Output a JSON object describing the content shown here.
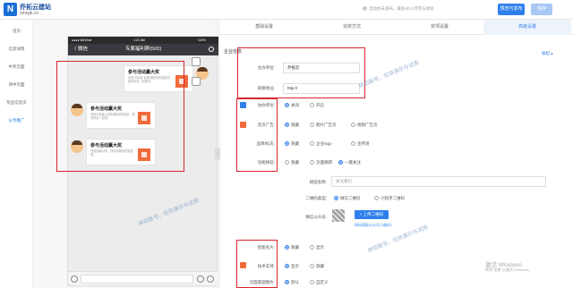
{
  "header": {
    "logo_mark": "N",
    "logo_name": "乔拓云建站",
    "logo_url": "xmsgk.cn",
    "notice": "活动尚未发布，最多20人可参与体验",
    "publish_label": "预览与发布",
    "save_label": "保存"
  },
  "nav": {
    "items": [
      "首页",
      "信息详情",
      "中奖页面",
      "领中页面",
      "奖品信息页",
      "分享推广"
    ]
  },
  "phone": {
    "carrier": "●●●● WeChat",
    "time": "1:21 AM",
    "battery": "100%",
    "back_label": "〈 微信",
    "title": "专属福利群(500)",
    "messages": [
      {
        "title": "参与活动赢大奖",
        "desc": "你是中奖者! 赶快领取你的奖品吧，邀请好友一起参与。"
      },
      {
        "title": "参与活动赢大奖",
        "desc": "你是中奖者! 赶快领取你的奖品，邀请好友一起来。"
      },
      {
        "title": "参与活动赢大奖",
        "desc": "开奖结果公布，快来领取你的奖品吧。"
      }
    ]
  },
  "tabs": [
    "基础设置",
    "派奖方式",
    "奖项设置",
    "高级设置"
  ],
  "settings": {
    "section_title": "企业信息",
    "collapse_link": "收起 ▴",
    "sponsor_label": "主办单位:",
    "sponsor_value": "乔拓云",
    "url_label": "链接地址:",
    "url_value": "http://",
    "coorg_label": "协办单位:",
    "coorg_options": [
      "关闭",
      "开启"
    ],
    "ad_label": "首页广告:",
    "ad_options": [
      "隐藏",
      "图片广告页",
      "视频广告页"
    ],
    "brand_label": "品牌/标志:",
    "brand_options": [
      "隐藏",
      "企业logo",
      "宣传语"
    ],
    "func_label": "功能按钮:",
    "func_options": [
      "隐藏",
      "页面跳转",
      "一键关注"
    ],
    "btn_name_label": "按钮名称:",
    "btn_name_value": "关注我们",
    "qr_type_label": "二维码类型:",
    "qr_type_options": [
      "微信二维码",
      "小程序二维码"
    ],
    "wechat_label": "微信公众号:",
    "upload_label": "+ 上传二维码",
    "howto_link": "如何获取公众号二维码?",
    "smart_label": "智能名片:",
    "smart_options": [
      "隐藏",
      "显示"
    ],
    "tech_label": "技术支持:",
    "tech_options": [
      "显示",
      "隐藏"
    ],
    "bottom_label": "页面底部图片:",
    "bottom_options": [
      "默认",
      "自定义"
    ]
  },
  "watermark": "体验账号，仅供演示与试用",
  "activate": {
    "title": "激活 Windows",
    "sub": "转到\"设置\"以激活 Windows。"
  },
  "colors": {
    "accent": "#2f80ed",
    "highlight_box": "#d9252c"
  }
}
